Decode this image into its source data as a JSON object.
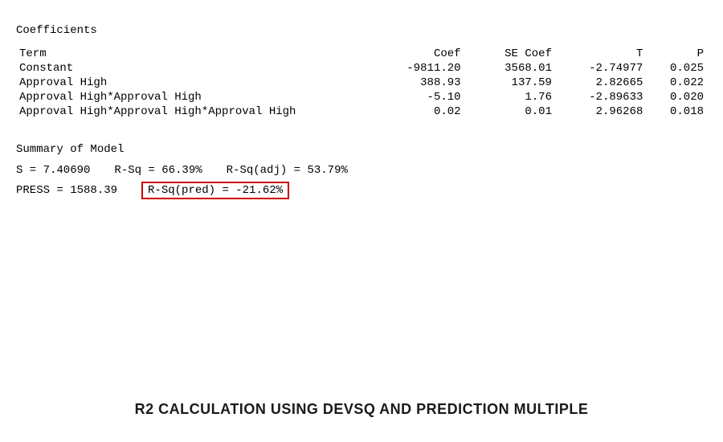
{
  "coefficients": {
    "section_title": "Coefficients",
    "headers": {
      "term": "Term",
      "coef": "Coef",
      "se_coef": "SE Coef",
      "t": "T",
      "p": "P"
    },
    "rows": [
      {
        "term": "Constant",
        "coef": "-9811.20",
        "se_coef": "3568.01",
        "t": "-2.74977",
        "p": "0.025"
      },
      {
        "term": "Approval High",
        "coef": "388.93",
        "se_coef": "137.59",
        "t": "2.82665",
        "p": "0.022"
      },
      {
        "term": "Approval High*Approval High",
        "coef": "-5.10",
        "se_coef": "1.76",
        "t": "-2.89633",
        "p": "0.020"
      },
      {
        "term": "Approval High*Approval High*Approval High",
        "coef": "0.02",
        "se_coef": "0.01",
        "t": "2.96268",
        "p": "0.018"
      }
    ]
  },
  "summary": {
    "section_title": "Summary of Model",
    "s_label": "S = 7.40690",
    "rsq_label": "R-Sq = 66.39%",
    "rsq_adj_label": "R-Sq(adj) = 53.79%",
    "press_label": "PRESS = 1588.39",
    "rsq_pred_label": "R-Sq(pred) = -21.62%"
  },
  "bottom_title": "R2 Calculation Using DEVSQ and Prediction Multiple"
}
